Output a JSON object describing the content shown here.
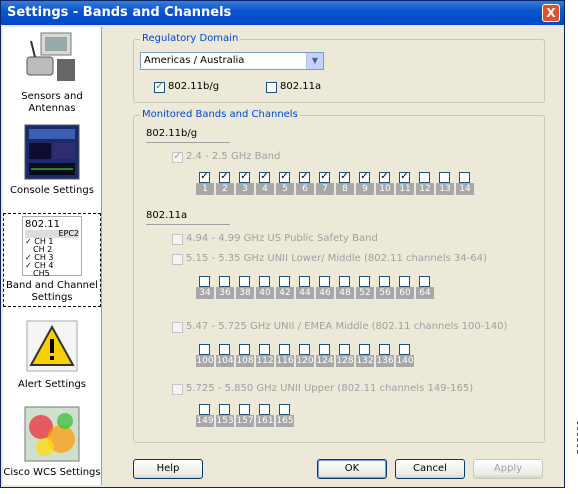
{
  "window": {
    "title": "Settings - Bands and Channels",
    "close": "X"
  },
  "nav": [
    {
      "label": "Sensors and Antennas"
    },
    {
      "label": "Console Settings"
    },
    {
      "label": "Band and Channel Settings",
      "icon_lines": [
        "802.11",
        "EPC2",
        "✓ CH 1",
        "CH 2",
        "✓ CH 3",
        "✓ CH 4",
        "CH5"
      ]
    },
    {
      "label": "Alert Settings"
    },
    {
      "label": "Cisco WCS Settings"
    }
  ],
  "regulatory": {
    "group_title": "Regulatory Domain",
    "domain": "Americas / Australia",
    "opt_bg": {
      "label": "802.11b/g",
      "checked": true
    },
    "opt_a": {
      "label": "802.11a",
      "checked": false
    }
  },
  "monitored": {
    "group_title": "Monitored Bands and Channels",
    "bg_heading": "802.11b/g",
    "bg_band": {
      "label": "2.4 - 2.5 GHz Band",
      "checked": true
    },
    "bg_channels": [
      {
        "n": "1",
        "c": true
      },
      {
        "n": "2",
        "c": true
      },
      {
        "n": "3",
        "c": true
      },
      {
        "n": "4",
        "c": true
      },
      {
        "n": "5",
        "c": true
      },
      {
        "n": "6",
        "c": true
      },
      {
        "n": "7",
        "c": true
      },
      {
        "n": "8",
        "c": true
      },
      {
        "n": "9",
        "c": true
      },
      {
        "n": "10",
        "c": true
      },
      {
        "n": "11",
        "c": true
      },
      {
        "n": "12",
        "c": false
      },
      {
        "n": "13",
        "c": false
      },
      {
        "n": "14",
        "c": false
      }
    ],
    "a_heading": "802.11a",
    "a_bands": [
      {
        "label": "4.94 - 4.99 GHz US Public Safety Band",
        "channels": []
      },
      {
        "label": "5.15 - 5.35 GHz UNII Lower/ Middle (802.11 channels 34-64)",
        "channels": [
          "34",
          "36",
          "38",
          "40",
          "42",
          "44",
          "46",
          "48",
          "52",
          "56",
          "60",
          "64"
        ]
      },
      {
        "label": "5.47 - 5.725 GHz UNII / EMEA Middle (802.11 channels 100-140)",
        "channels": [
          "100",
          "104",
          "108",
          "112",
          "116",
          "120",
          "124",
          "128",
          "132",
          "136",
          "140"
        ]
      },
      {
        "label": "5.725 - 5.850 GHz UNII Upper (802.11 channels 149-165)",
        "channels": [
          "149",
          "153",
          "157",
          "161",
          "165"
        ]
      }
    ]
  },
  "buttons": {
    "help": "Help",
    "ok": "OK",
    "cancel": "Cancel",
    "apply": "Apply"
  },
  "side_code": "208000"
}
